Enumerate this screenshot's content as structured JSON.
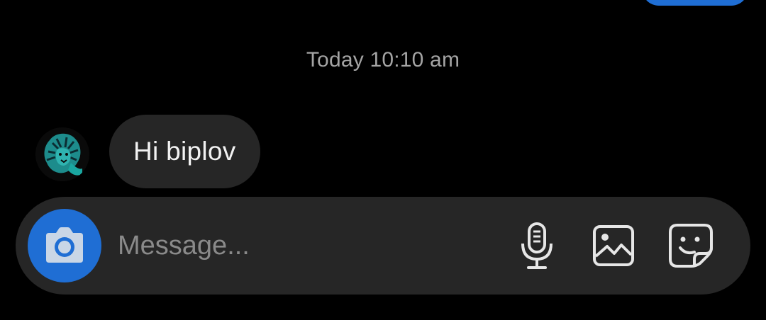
{
  "thread": {
    "timestamp": "Today 10:10 am",
    "messages": [
      {
        "sender": "other",
        "text": "Hi biplov"
      }
    ]
  },
  "composer": {
    "placeholder": "Message...",
    "value": ""
  },
  "icons": {
    "camera": "camera-icon",
    "mic": "microphone-icon",
    "gallery": "image-gallery-icon",
    "sticker": "sticker-icon",
    "avatar": "lion-avatar"
  },
  "colors": {
    "background": "#000000",
    "bubble": "#262626",
    "composer": "#262626",
    "accent": "#1f6ed4",
    "timestamp": "#a4a4a4",
    "placeholder": "#8a8a8a",
    "icon": "#e6e6e6"
  }
}
